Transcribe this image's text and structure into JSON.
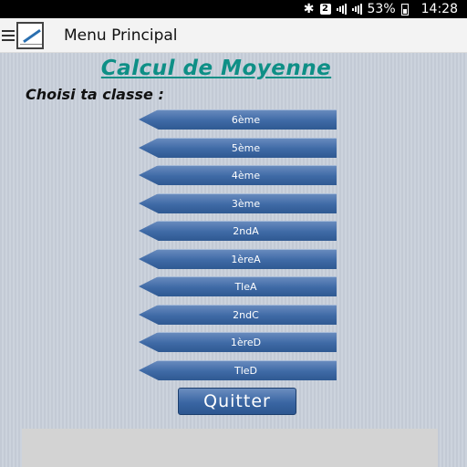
{
  "status_bar": {
    "sim_badge": "2",
    "battery_percent": "53%",
    "time": "14:28"
  },
  "action_bar": {
    "title": "Menu Principal"
  },
  "main": {
    "title": "Calcul de Moyenne",
    "subtitle": "Choisi ta classe :",
    "classes": [
      "6ème",
      "5ème",
      "4ème",
      "3ème",
      "2ndA",
      "1èreA",
      "TleA",
      "2ndC",
      "1èreD",
      "TleD"
    ],
    "quit_label": "Quitter"
  },
  "colors": {
    "title_teal": "#0e8f86",
    "button_blue": "#3f6aa6",
    "background": "#c5ccd6"
  },
  "icons": {
    "bluetooth": "bluetooth-icon",
    "signal": "signal-icon",
    "battery": "battery-icon",
    "menu": "hamburger-menu-icon",
    "app": "notepad-icon"
  }
}
